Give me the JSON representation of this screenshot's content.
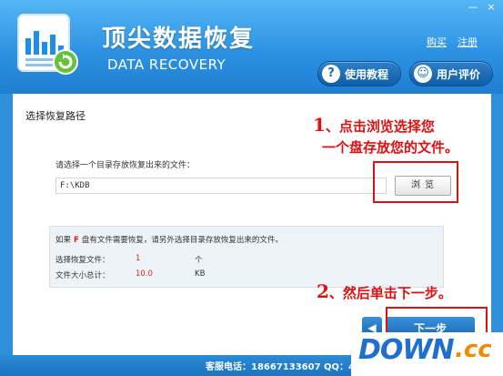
{
  "window": {
    "controls": [
      "—",
      "×"
    ]
  },
  "header": {
    "title": "顶尖数据恢复",
    "subtitle": "DATA RECOVERY",
    "links": {
      "buy": "购买",
      "register": "注册"
    },
    "tutorial_button": {
      "icon": "question-icon",
      "label": "使用教程"
    },
    "review_button": {
      "icon": "smiley-icon",
      "label": "用户评价"
    }
  },
  "main": {
    "section_title": "选择恢复路径",
    "prompt": "请选择一个目录存放恢复出来的文件：",
    "path_value": "F:\\KDB",
    "browse_label": "浏览",
    "info": {
      "note_prefix": "如果",
      "drive": "F",
      "note_suffix": "盘有文件需要恢复，请另外选择目录存放恢复出来的文件。",
      "count_label": "选择恢复文件：",
      "count_value": "1",
      "count_unit": "个",
      "size_label": "文件大小总计：",
      "size_value": "10.0",
      "size_unit": "KB"
    },
    "prev_label": "◀",
    "next_label": "下一步"
  },
  "annotations": {
    "step1_num": "1",
    "step1_line1": "、点击浏览选择您",
    "step1_line2": "一个盘存放您的文件。",
    "step2_num": "2",
    "step2_text": "、然后单击下一步。",
    "color": "#e01010"
  },
  "footer": {
    "text": "客服电话：18667133607  QQ：4"
  },
  "watermark": {
    "down": "DOWN",
    "cc": ".cc"
  },
  "colors": {
    "header_blue": "#2d92e2",
    "accent_red": "#e02020"
  }
}
